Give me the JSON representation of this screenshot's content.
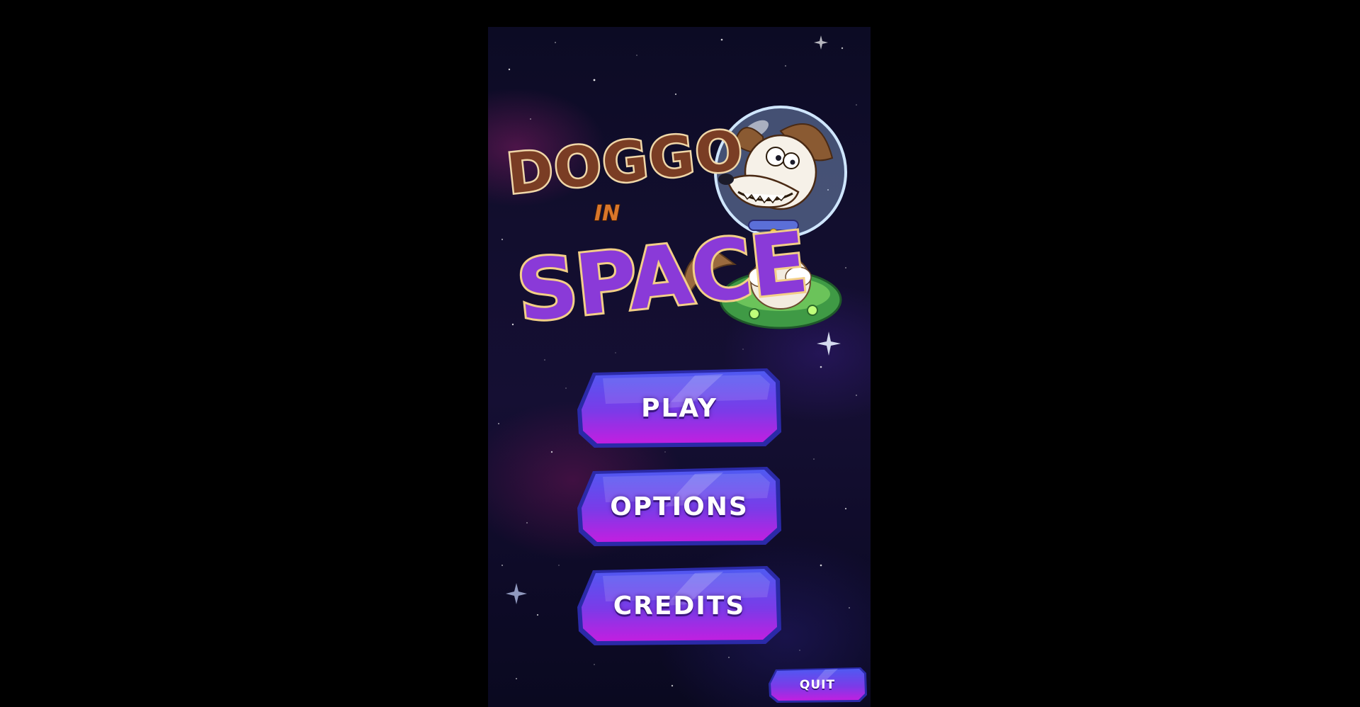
{
  "game": {
    "title_line1": "DOGGO",
    "title_line2": "IN",
    "title_line3": "SPACE",
    "mascot": "astronaut-dog-in-ufo"
  },
  "menu": {
    "play_label": "PLAY",
    "options_label": "OPTIONS",
    "credits_label": "CREDITS",
    "quit_label": "QUIT"
  },
  "colors": {
    "background": "#000000",
    "space": "#120e2e",
    "button_top": "#5a4df0",
    "button_bottom": "#b620e6",
    "title_brown": "#7a3d24",
    "title_purple": "#8a3ad8",
    "title_outline": "#f0d7a8"
  }
}
